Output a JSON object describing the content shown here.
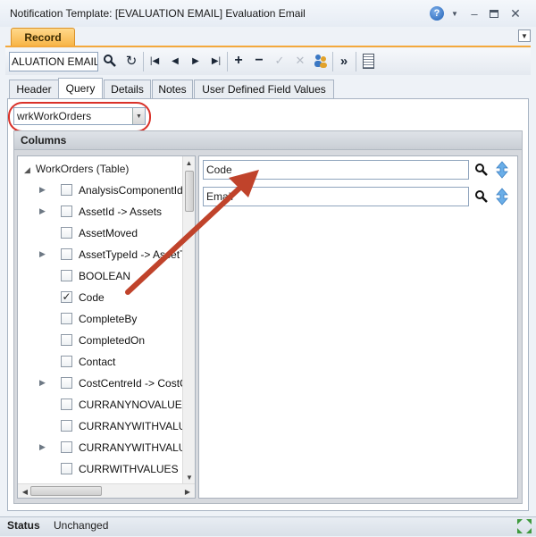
{
  "window": {
    "title": "Notification Template: [EVALUATION EMAIL] Evaluation Email"
  },
  "record_tab": {
    "label": "Record"
  },
  "toolbar": {
    "record_value": "ALUATION EMAIL"
  },
  "tabs": [
    {
      "label": "Header"
    },
    {
      "label": "Query"
    },
    {
      "label": "Details"
    },
    {
      "label": "Notes"
    },
    {
      "label": "User Defined Field Values"
    }
  ],
  "query": {
    "selected": "wrkWorkOrders"
  },
  "columns": {
    "header": "Columns",
    "root": "WorkOrders (Table)",
    "items": [
      {
        "label": "AnalysisComponentId",
        "expandable": true,
        "checked": false
      },
      {
        "label": "AssetId -> Assets",
        "expandable": true,
        "checked": false
      },
      {
        "label": "AssetMoved",
        "expandable": false,
        "checked": false
      },
      {
        "label": "AssetTypeId -> AssetTypes",
        "expandable": true,
        "checked": false
      },
      {
        "label": "BOOLEAN",
        "expandable": false,
        "checked": false
      },
      {
        "label": "Code",
        "expandable": false,
        "checked": true
      },
      {
        "label": "CompleteBy",
        "expandable": false,
        "checked": false
      },
      {
        "label": "CompletedOn",
        "expandable": false,
        "checked": false
      },
      {
        "label": "Contact",
        "expandable": false,
        "checked": false
      },
      {
        "label": "CostCentreId -> CostCentres",
        "expandable": true,
        "checked": false
      },
      {
        "label": "CURRANYNOVALUE",
        "expandable": false,
        "checked": false
      },
      {
        "label": "CURRANYWITHVALUE",
        "expandable": false,
        "checked": false
      },
      {
        "label": "CURRANYWITHVALUES",
        "expandable": true,
        "checked": false
      },
      {
        "label": "CURRWITHVALUES",
        "expandable": false,
        "checked": false
      }
    ],
    "selected_fields": [
      "Code",
      "Email"
    ]
  },
  "status": {
    "label": "Status",
    "value": "Unchanged"
  },
  "colors": {
    "accent": "#f4a93c",
    "annotation": "#c0432b",
    "oval": "#d9322a"
  }
}
